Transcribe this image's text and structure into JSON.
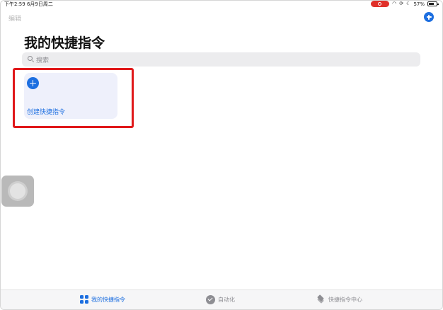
{
  "status_bar": {
    "time": "下午2:59  6月9日周二",
    "battery_percent": "57%",
    "recording_color": "#e0302a"
  },
  "nav": {
    "edit_label": "编辑",
    "add_icon": "plus-circle-icon"
  },
  "page": {
    "title": "我的快捷指令"
  },
  "search": {
    "placeholder": "搜索"
  },
  "shortcut_card": {
    "label": "创建快捷指令",
    "icon": "plus-circle-icon"
  },
  "tab_bar": {
    "tabs": [
      {
        "label": "我的快捷指令",
        "icon": "grid-icon",
        "active": true
      },
      {
        "label": "自动化",
        "icon": "clock-check-icon",
        "active": false
      },
      {
        "label": "快捷指令中心",
        "icon": "layers-icon",
        "active": false
      }
    ]
  },
  "colors": {
    "accent": "#1d6fe0",
    "highlight_border": "#e0181a",
    "card_bg": "#eef0fb"
  }
}
